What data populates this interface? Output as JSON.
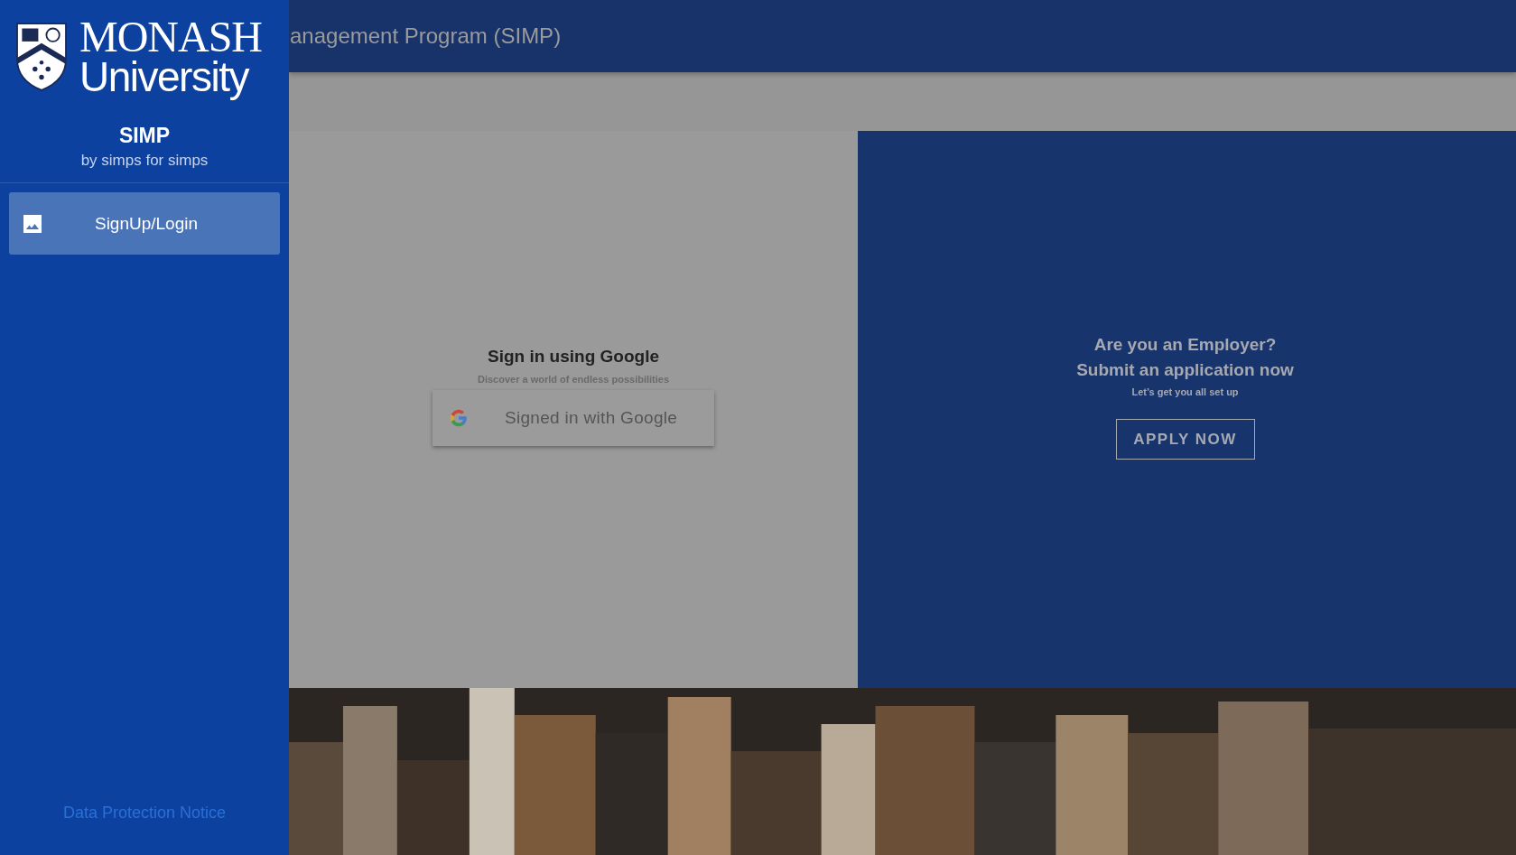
{
  "header": {
    "title": "anagement Program (SIMP)"
  },
  "sidebar": {
    "logo": {
      "name": "MONASH",
      "subname": "University"
    },
    "app_name": "SIMP",
    "tagline": "by simps for simps",
    "items": [
      {
        "label": "SignUp/Login",
        "selected": true
      }
    ],
    "footer_link": "Data Protection Notice"
  },
  "google_card": {
    "title": "Sign in using Google",
    "subtitle": "Discover a world of endless possibilities",
    "button": "Signed in with Google"
  },
  "employer_card": {
    "title": "Are you an Employer?",
    "title_line2": "Submit an application now",
    "subtitle": "Let’s get you all set up",
    "button": "APPLY NOW"
  }
}
